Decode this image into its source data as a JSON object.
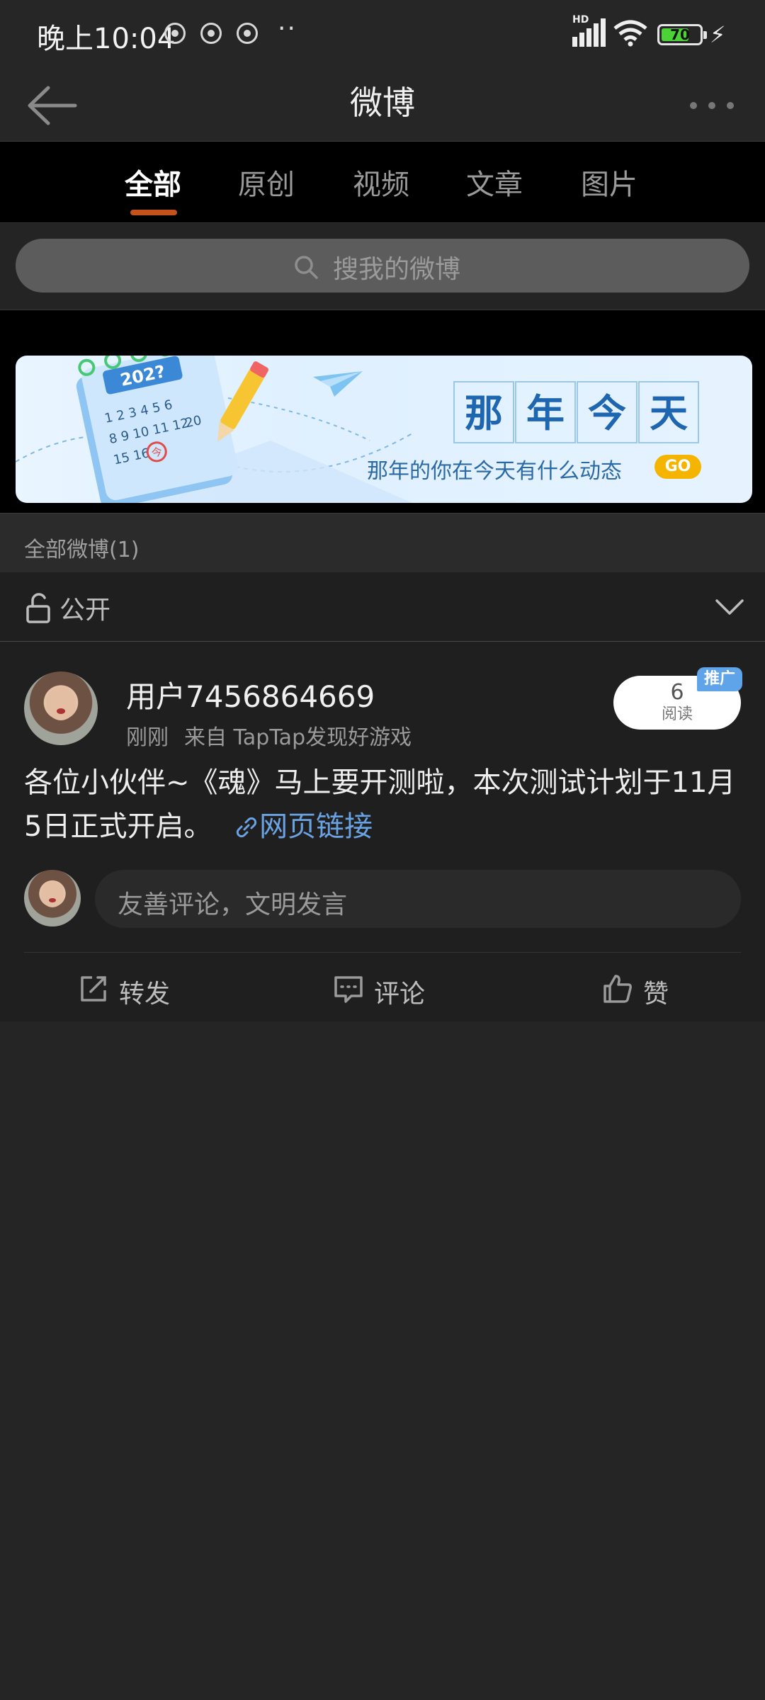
{
  "status_bar": {
    "time": "晚上10:04",
    "network_label": "HD",
    "battery": "70",
    "extra_dots": "··"
  },
  "header": {
    "title": "微博"
  },
  "tabs": [
    {
      "label": "全部",
      "active": true
    },
    {
      "label": "原创",
      "active": false
    },
    {
      "label": "视频",
      "active": false
    },
    {
      "label": "文章",
      "active": false
    },
    {
      "label": "图片",
      "active": false
    }
  ],
  "search": {
    "placeholder": "搜我的微博"
  },
  "banner": {
    "title_chars": [
      "那",
      "年",
      "今",
      "天"
    ],
    "subtitle": "那年的你在今天有什么动态",
    "go_label": "GO",
    "calendar_year": "202?",
    "calendar_rows": [
      "1 2 3 4 5 6",
      "8 9 10 11 12",
      "15 16"
    ],
    "calendar_mark": "今",
    "calendar_extra": "20"
  },
  "section": {
    "label": "全部微博(1)",
    "privacy": "公开"
  },
  "post": {
    "username": "用户7456864669",
    "time": "刚刚",
    "source": "来自 TapTap发现好游戏",
    "read_count": "6",
    "read_label": "阅读",
    "promo_badge": "推广",
    "text": "各位小伙伴~《魂》马上要开测啦，本次测试计划于11月5日正式开启。",
    "link_label": "网页链接",
    "comment_placeholder": "友善评论，文明发言"
  },
  "actions": {
    "repost": "转发",
    "comment": "评论",
    "like": "赞"
  },
  "colors": {
    "accent": "#c4521b",
    "link": "#6aa3e4",
    "promo": "#5fa3e8",
    "go": "#f5b400"
  }
}
